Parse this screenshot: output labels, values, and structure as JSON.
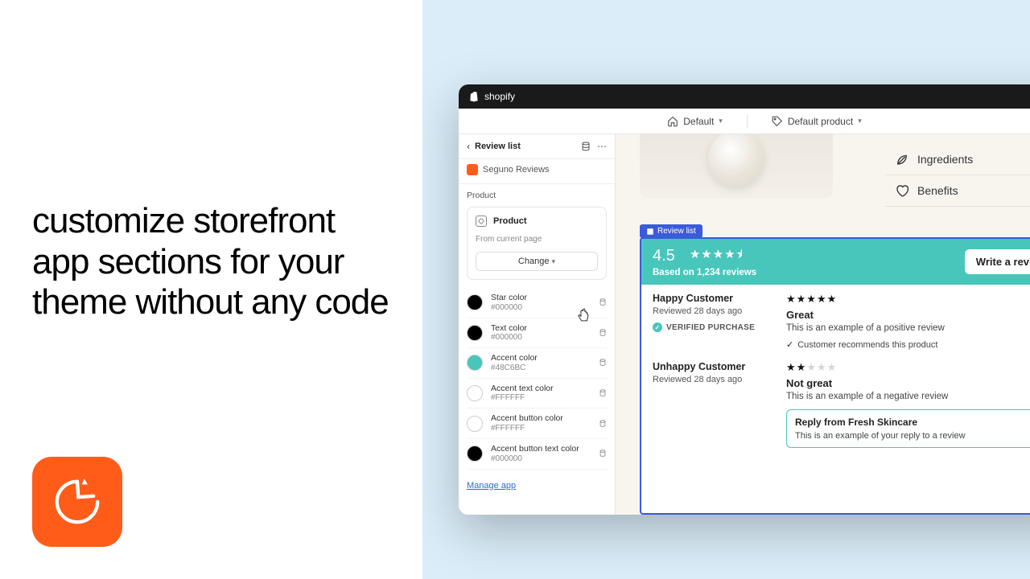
{
  "left": {
    "heading": "customize storefront app sections for your theme without any code"
  },
  "topbar": {
    "brand": "shopify"
  },
  "subbar": {
    "template_label": "Default",
    "product_label": "Default product"
  },
  "sidebar": {
    "title": "Review list",
    "app_name": "Seguno Reviews",
    "section_label": "Product",
    "product_card": {
      "title": "Product",
      "subtitle": "From current page",
      "change_label": "Change"
    },
    "colors": [
      {
        "name": "Star color",
        "hex": "#000000",
        "swatch": "#000000"
      },
      {
        "name": "Text color",
        "hex": "#000000",
        "swatch": "#000000"
      },
      {
        "name": "Accent color",
        "hex": "#48C6BC",
        "swatch": "#48C6BC"
      },
      {
        "name": "Accent text color",
        "hex": "#FFFFFF",
        "swatch": "#FFFFFF"
      },
      {
        "name": "Accent button color",
        "hex": "#FFFFFF",
        "swatch": "#FFFFFF"
      },
      {
        "name": "Accent button text color",
        "hex": "#000000",
        "swatch": "#000000"
      }
    ],
    "manage_link": "Manage app"
  },
  "preview": {
    "accordion": [
      {
        "label": "Ingredients",
        "icon": "leaf"
      },
      {
        "label": "Benefits",
        "icon": "heart"
      }
    ],
    "tag": "Review list",
    "widget": {
      "score": "4.5",
      "count_line": "Based on 1,234 reviews",
      "write_label": "Write a review",
      "reviews": [
        {
          "name": "Happy Customer",
          "date": "Reviewed 28 days ago",
          "verified": "VERIFIED PURCHASE",
          "stars_full": 5,
          "stars_empty": 0,
          "title": "Great",
          "text": "This is an example of a positive review",
          "recommend": "Customer recommends this product"
        },
        {
          "name": "Unhappy Customer",
          "date": "Reviewed 28 days ago",
          "stars_full": 2,
          "stars_empty": 3,
          "title": "Not great",
          "text": "This is an example of a negative review",
          "reply_title": "Reply from Fresh Skincare",
          "reply_text": "This is an example of your reply to a review"
        }
      ]
    }
  }
}
